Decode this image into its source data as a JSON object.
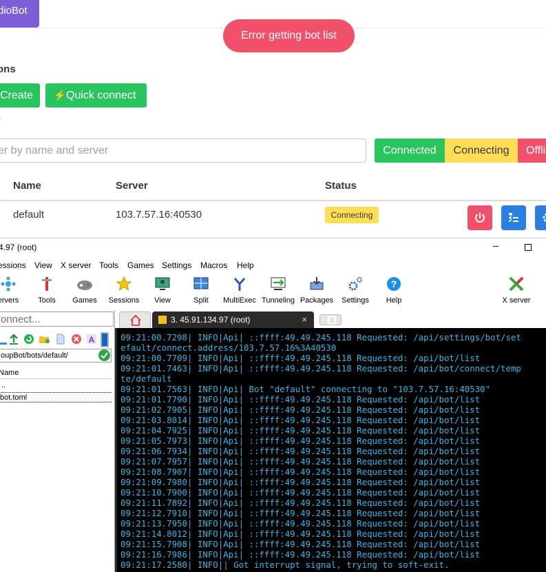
{
  "web": {
    "brand": "dioBot",
    "toast": "Error getting bot list",
    "section_title": "ons",
    "buttons": {
      "create": "Create",
      "quick_connect": "Quick connect"
    },
    "filter_label": "r",
    "filter_placeholder": "er by name and server",
    "status_filters": {
      "connected": "Connected",
      "connecting": "Connecting",
      "offline": "Offli"
    },
    "table": {
      "headers": {
        "name": "Name",
        "server": "Server",
        "status": "Status"
      },
      "rows": [
        {
          "name": "default",
          "server": "103.7.57.16:40530",
          "status": "Connecting"
        }
      ]
    },
    "colors": {
      "brand": "#7c5fd6",
      "danger": "#f1506a",
      "success": "#28c55e",
      "warning": "#ffdd57",
      "info": "#2a7fe0"
    }
  },
  "window": {
    "title": "4.97 (root)",
    "menu": [
      "essions",
      "View",
      "X server",
      "Tools",
      "Games",
      "Settings",
      "Macros",
      "Help"
    ],
    "toolbar": [
      "ervers",
      "Tools",
      "Games",
      "Sessions",
      "View",
      "Split",
      "MultiExec",
      "Tunneling",
      "Packages",
      "Settings",
      "Help",
      "X server"
    ],
    "quick_connect_placeholder": "onnect...",
    "path": "oupBot/bots/default/",
    "file_header": "Name",
    "files": [
      "..",
      "bot.toml"
    ],
    "tab_title": "3. 45.91.134.97 (root)",
    "tab_close": "×"
  },
  "terminal": {
    "lines": [
      "09:21:00.7298| INFO|Api| ::ffff:49.49.245.118 Requested: /api/settings/bot/set",
      "efault/connect.address/103.7.57.16%3A40530",
      "09:21:00.7709| INFO|Api| ::ffff:49.49.245.118 Requested: /api/bot/list",
      "09:21:01.7463| INFO|Api| ::ffff:49.49.245.118 Requested: /api/bot/connect/temp",
      "te/default",
      "09:21:01.7563| INFO|Api| Bot \"default\" connecting to \"103.7.57.16:40530\"",
      "09:21:01.7790| INFO|Api| ::ffff:49.49.245.118 Requested: /api/bot/list",
      "09:21:02.7905| INFO|Api| ::ffff:49.49.245.118 Requested: /api/bot/list",
      "09:21:03.8014| INFO|Api| ::ffff:49.49.245.118 Requested: /api/bot/list",
      "09:21:04.7925| INFO|Api| ::ffff:49.49.245.118 Requested: /api/bot/list",
      "09:21:05.7973| INFO|Api| ::ffff:49.49.245.118 Requested: /api/bot/list",
      "09:21:06.7934| INFO|Api| ::ffff:49.49.245.118 Requested: /api/bot/list",
      "09:21:07.7957| INFO|Api| ::ffff:49.49.245.118 Requested: /api/bot/list",
      "09:21:08.7907| INFO|Api| ::ffff:49.49.245.118 Requested: /api/bot/list",
      "09:21:09.7980| INFO|Api| ::ffff:49.49.245.118 Requested: /api/bot/list",
      "09:21:10.7900| INFO|Api| ::ffff:49.49.245.118 Requested: /api/bot/list",
      "09:21:11.7892| INFO|Api| ::ffff:49.49.245.118 Requested: /api/bot/list",
      "09:21:12.7910| INFO|Api| ::ffff:49.49.245.118 Requested: /api/bot/list",
      "09:21:13.7950| INFO|Api| ::ffff:49.49.245.118 Requested: /api/bot/list",
      "09:21:14.8012| INFO|Api| ::ffff:49.49.245.118 Requested: /api/bot/list",
      "09:21:15.7908| INFO|Api| ::ffff:49.49.245.118 Requested: /api/bot/list",
      "09:21:16.7986| INFO|Api| ::ffff:49.49.245.118 Requested: /api/bot/list",
      "09:21:17.2580| INFO|| Got interrupt signal, trying to soft-exit."
    ]
  }
}
